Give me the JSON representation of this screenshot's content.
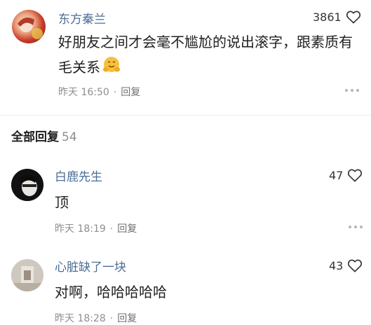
{
  "main_comment": {
    "author": "东方秦兰",
    "likes": "3861",
    "text": "好朋友之间才会毫不尴尬的说出滚字，跟素质有毛关系",
    "emoji": "hug-emoji",
    "time": "昨天 16:50",
    "reply_label": "回复"
  },
  "replies_header": {
    "title": "全部回复",
    "count": "54"
  },
  "replies": [
    {
      "author": "白鹿先生",
      "likes": "47",
      "text": "顶",
      "time": "昨天 18:19",
      "reply_label": "回复"
    },
    {
      "author": "心脏缺了一块",
      "likes": "43",
      "text": "对啊，哈哈哈哈哈",
      "time": "昨天 18:28",
      "reply_label": "回复"
    }
  ],
  "colors": {
    "name": "#4c6d97",
    "meta": "#8e8e8e",
    "divider": "#ececec"
  }
}
